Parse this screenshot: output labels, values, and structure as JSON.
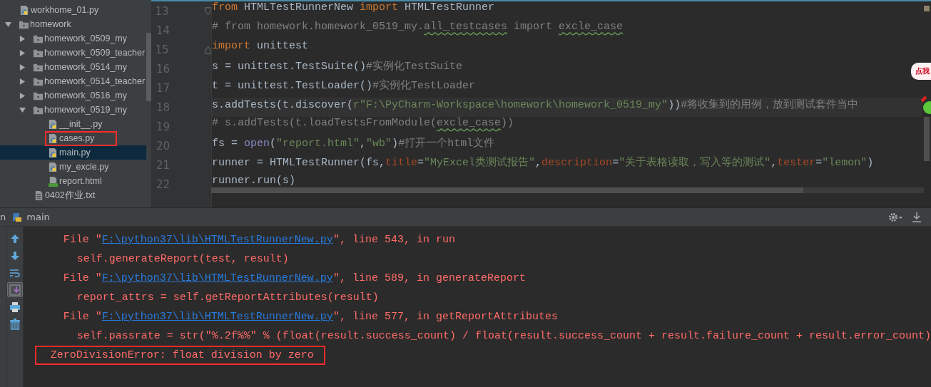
{
  "project_tree": [
    {
      "label": "workhome_01.py",
      "kind": "python",
      "selected": false,
      "annotated": false
    },
    {
      "label": "homework",
      "kind": "folder",
      "expanded": true,
      "selected": false,
      "annotated": false,
      "children": [
        {
          "label": "homework_0509_my",
          "kind": "folder",
          "expanded": false,
          "selected": false,
          "annotated": false
        },
        {
          "label": "homework_0509_teacher",
          "kind": "folder",
          "expanded": false,
          "selected": false,
          "annotated": false
        },
        {
          "label": "homework_0514_my",
          "kind": "folder",
          "expanded": false,
          "selected": false,
          "annotated": false
        },
        {
          "label": "homework_0514_teacher",
          "kind": "folder",
          "expanded": false,
          "selected": false,
          "annotated": false
        },
        {
          "label": "homework_0516_my",
          "kind": "folder",
          "expanded": false,
          "selected": false,
          "annotated": false
        },
        {
          "label": "homework_0519_my",
          "kind": "folder",
          "expanded": true,
          "selected": false,
          "annotated": false,
          "children": [
            {
              "label": "__init__.py",
              "kind": "python",
              "selected": false,
              "annotated": false
            },
            {
              "label": "cases.py",
              "kind": "python",
              "selected": false,
              "annotated": true
            },
            {
              "label": "main.py",
              "kind": "python",
              "selected": true,
              "annotated": false
            },
            {
              "label": "my_excle.py",
              "kind": "python",
              "selected": false,
              "annotated": false
            },
            {
              "label": "report.html",
              "kind": "html",
              "selected": false,
              "annotated": false
            }
          ]
        },
        {
          "label": "0402作业.txt",
          "kind": "text",
          "selected": false,
          "annotated": false
        }
      ]
    }
  ],
  "editor": {
    "lines": [
      {
        "number": "13",
        "kind": "fold-start",
        "selected": false,
        "tokens": [
          {
            "text": "from",
            "kind": "keyword"
          },
          {
            "text": " HTMLTestRunnerNew ",
            "kind": "plain"
          },
          {
            "text": "import",
            "kind": "keyword"
          },
          {
            "text": " HTMLTestRunner",
            "kind": "plain"
          }
        ]
      },
      {
        "number": "14",
        "kind": "plain",
        "selected": false,
        "tokens": [
          {
            "text": "# from homework.homework_0519_my.",
            "kind": "comment"
          },
          {
            "text": "all_testcases",
            "kind": "comment",
            "squiggly": true
          },
          {
            "text": " import ",
            "kind": "comment"
          },
          {
            "text": "excle_case",
            "kind": "comment",
            "squiggly": true
          }
        ]
      },
      {
        "number": "15",
        "kind": "fold-end",
        "selected": false,
        "tokens": [
          {
            "text": "import",
            "kind": "keyword"
          },
          {
            "text": " unittest",
            "kind": "plain"
          }
        ]
      },
      {
        "number": "16",
        "kind": "plain",
        "selected": false,
        "tokens": [
          {
            "text": "s = unittest.TestSuite()",
            "kind": "plain"
          },
          {
            "text": "#实例化TestSuite",
            "kind": "comment"
          }
        ]
      },
      {
        "number": "17",
        "kind": "plain",
        "selected": false,
        "tokens": [
          {
            "text": "t = unittest.TestLoader()",
            "kind": "plain"
          },
          {
            "text": "#实例化TestLoader",
            "kind": "comment"
          }
        ]
      },
      {
        "number": "18",
        "kind": "plain",
        "selected": true,
        "tokens": [
          {
            "text": "s.addTests(t.discover(",
            "kind": "plain"
          },
          {
            "text": "r\"F:\\PyCharm-Workspace\\homework\\homework_0519_my\"",
            "kind": "string"
          },
          {
            "text": "))",
            "kind": "plain"
          },
          {
            "text": "#将收集到的用例，放到测试套件当中",
            "kind": "comment"
          }
        ]
      },
      {
        "number": "19",
        "kind": "plain",
        "selected": false,
        "tokens": [
          {
            "text": "# s.addTests(t.loadTestsFromModule(",
            "kind": "comment"
          },
          {
            "text": "excle_case",
            "kind": "comment",
            "squiggly": true
          },
          {
            "text": "))",
            "kind": "comment"
          }
        ]
      },
      {
        "number": "20",
        "kind": "plain",
        "selected": false,
        "tokens": [
          {
            "text": "fs = ",
            "kind": "plain"
          },
          {
            "text": "open",
            "kind": "builtin"
          },
          {
            "text": "(",
            "kind": "plain"
          },
          {
            "text": "\"report.html\"",
            "kind": "string"
          },
          {
            "text": ",",
            "kind": "plain"
          },
          {
            "text": "\"wb\"",
            "kind": "string"
          },
          {
            "text": ")",
            "kind": "plain"
          },
          {
            "text": "#打开一个html文件",
            "kind": "comment"
          }
        ]
      },
      {
        "number": "21",
        "kind": "plain",
        "selected": false,
        "tokens": [
          {
            "text": "runner = HTMLTestRunner(fs,",
            "kind": "plain"
          },
          {
            "text": "title",
            "kind": "param"
          },
          {
            "text": "=",
            "kind": "plain"
          },
          {
            "text": "\"MyExcel类测试报告\"",
            "kind": "string"
          },
          {
            "text": ",",
            "kind": "plain"
          },
          {
            "text": "description",
            "kind": "param"
          },
          {
            "text": "=",
            "kind": "plain"
          },
          {
            "text": "\"关于表格读取，写入等的测试\"",
            "kind": "string"
          },
          {
            "text": ",",
            "kind": "plain"
          },
          {
            "text": "tester",
            "kind": "param"
          },
          {
            "text": "=",
            "kind": "plain"
          },
          {
            "text": "\"lemon\"",
            "kind": "string"
          },
          {
            "text": ")",
            "kind": "plain"
          }
        ]
      },
      {
        "number": "22",
        "kind": "plain",
        "selected": false,
        "tokens": [
          {
            "text": "runner.run(s)",
            "kind": "plain"
          }
        ]
      }
    ]
  },
  "overlay_badge": {
    "text": "点我"
  },
  "run_panel": {
    "clipped_label": "n",
    "title": "main",
    "toolbar": [
      {
        "kind": "up",
        "pressed": false
      },
      {
        "kind": "down",
        "pressed": false
      },
      {
        "kind": "wrap",
        "pressed": false
      },
      {
        "kind": "scroll-end",
        "pressed": true
      },
      {
        "kind": "print",
        "pressed": false
      },
      {
        "kind": "trash",
        "pressed": false
      }
    ],
    "console": [
      {
        "kind": "frame",
        "annotated": false,
        "tokens": [
          {
            "text": "File \""
          },
          {
            "text": "F:\\python37\\lib\\HTMLTestRunnerNew.py",
            "link": true
          },
          {
            "text": "\", line 543, in run"
          }
        ]
      },
      {
        "kind": "source",
        "annotated": false,
        "tokens": [
          {
            "text": "self.generateReport(test, result)"
          }
        ]
      },
      {
        "kind": "frame",
        "annotated": false,
        "tokens": [
          {
            "text": "File \""
          },
          {
            "text": "F:\\python37\\lib\\HTMLTestRunnerNew.py",
            "link": true
          },
          {
            "text": "\", line 589, in generateReport"
          }
        ]
      },
      {
        "kind": "source",
        "annotated": false,
        "tokens": [
          {
            "text": "report_attrs = self.getReportAttributes(result)"
          }
        ]
      },
      {
        "kind": "frame",
        "annotated": false,
        "tokens": [
          {
            "text": "File \""
          },
          {
            "text": "F:\\python37\\lib\\HTMLTestRunnerNew.py",
            "link": true
          },
          {
            "text": "\", line 577, in getReportAttributes"
          }
        ]
      },
      {
        "kind": "source",
        "annotated": false,
        "tokens": [
          {
            "text": "self.passrate = str(\"%.2f%%\" % (float(result.success_count) / float(result.success_count + result.failure_count + result.error_count)"
          }
        ]
      },
      {
        "kind": "error",
        "annotated": true,
        "tokens": [
          {
            "text": "ZeroDivisionError: float division by zero"
          }
        ]
      }
    ]
  }
}
